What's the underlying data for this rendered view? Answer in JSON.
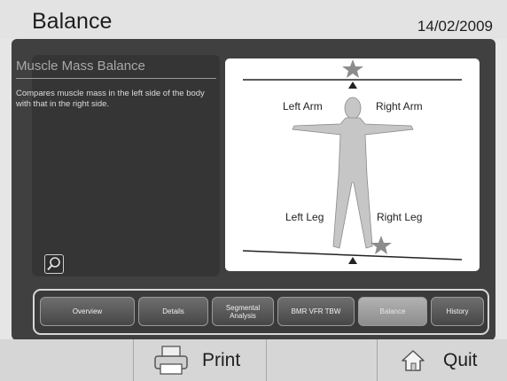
{
  "header": {
    "title": "Balance",
    "date": "14/02/2009"
  },
  "info": {
    "title": "Muscle Mass Balance",
    "description": "Compares muscle mass in the left side of the body with that in the right side."
  },
  "figure": {
    "labels": {
      "left_arm": "Left Arm",
      "right_arm": "Right Arm",
      "left_leg": "Left Leg",
      "right_leg": "Right Leg"
    }
  },
  "tabs": [
    {
      "label": "Overview"
    },
    {
      "label": "Details"
    },
    {
      "label": "Segmental Analysis"
    },
    {
      "label": "BMR VFR TBW"
    },
    {
      "label": "Balance"
    },
    {
      "label": "History"
    }
  ],
  "active_tab": "Balance",
  "footer": {
    "print_label": "Print",
    "quit_label": "Quit"
  },
  "icons": {
    "zoom": "magnifier-icon",
    "print": "printer-icon",
    "quit": "home-icon",
    "marker": "star-icon",
    "pointer": "triangle-up-icon"
  }
}
